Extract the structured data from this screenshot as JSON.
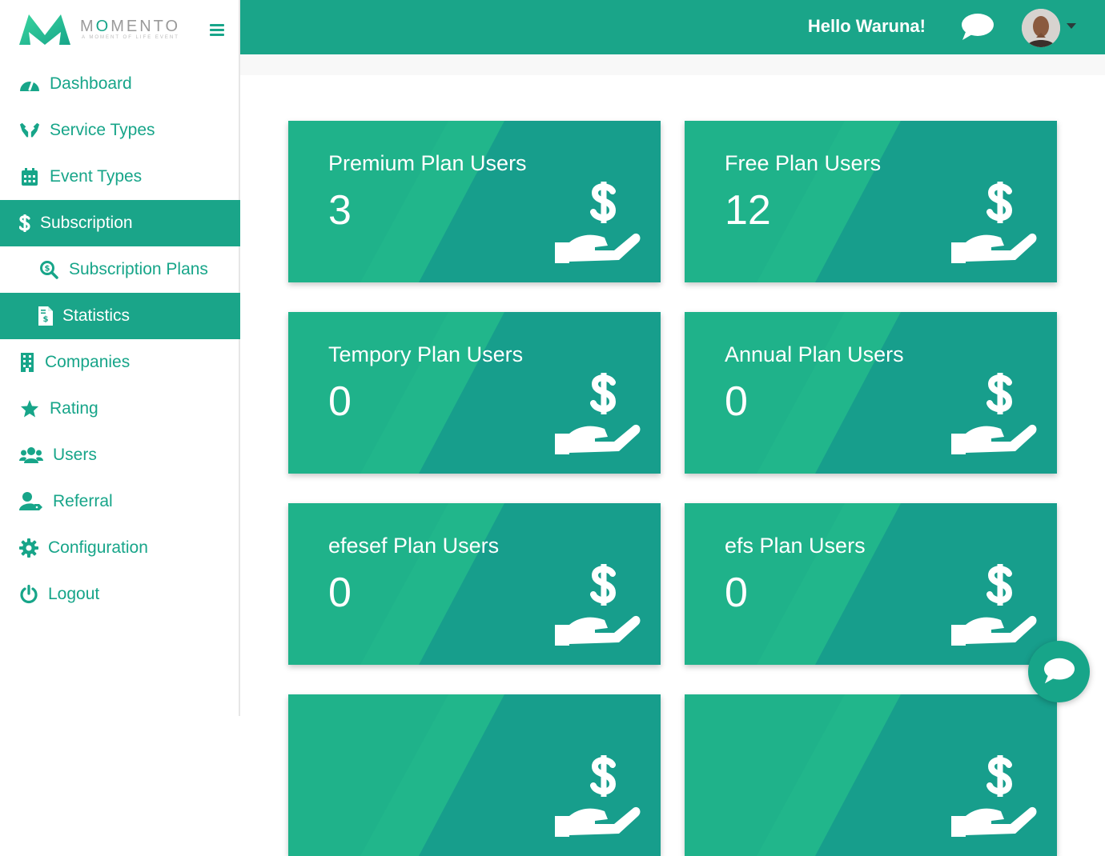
{
  "brand": {
    "name_pre": "M",
    "name_o": "O",
    "name_post": "MENTO",
    "tagline": "A MOMENT OF LIFE EVENT"
  },
  "header": {
    "greeting": "Hello Waruna!"
  },
  "sidebar": {
    "items": [
      {
        "label": "Dashboard",
        "icon": "dashboard-icon"
      },
      {
        "label": "Service Types",
        "icon": "hands-icon"
      },
      {
        "label": "Event Types",
        "icon": "calendar-icon"
      },
      {
        "label": "Subscription",
        "icon": "dollar-icon"
      },
      {
        "label": "Subscription Plans",
        "icon": "search-dollar-icon"
      },
      {
        "label": "Statistics",
        "icon": "invoice-icon"
      },
      {
        "label": "Companies",
        "icon": "building-icon"
      },
      {
        "label": "Rating",
        "icon": "star-icon"
      },
      {
        "label": "Users",
        "icon": "users-icon"
      },
      {
        "label": "Referral",
        "icon": "user-tag-icon"
      },
      {
        "label": "Configuration",
        "icon": "gear-icon"
      },
      {
        "label": "Logout",
        "icon": "power-icon"
      }
    ]
  },
  "cards": [
    {
      "title": "Premium Plan Users",
      "count": "3"
    },
    {
      "title": "Free Plan Users",
      "count": "12"
    },
    {
      "title": "Tempory Plan Users",
      "count": "0"
    },
    {
      "title": "Annual Plan Users",
      "count": "0"
    },
    {
      "title": "efesef Plan Users",
      "count": "0"
    },
    {
      "title": "efs Plan Users",
      "count": "0"
    },
    {
      "title": "",
      "count": ""
    },
    {
      "title": "",
      "count": ""
    }
  ],
  "colors": {
    "primary": "#1aa589",
    "card_dark": "#179e8c",
    "card_light": "#21b68b"
  }
}
